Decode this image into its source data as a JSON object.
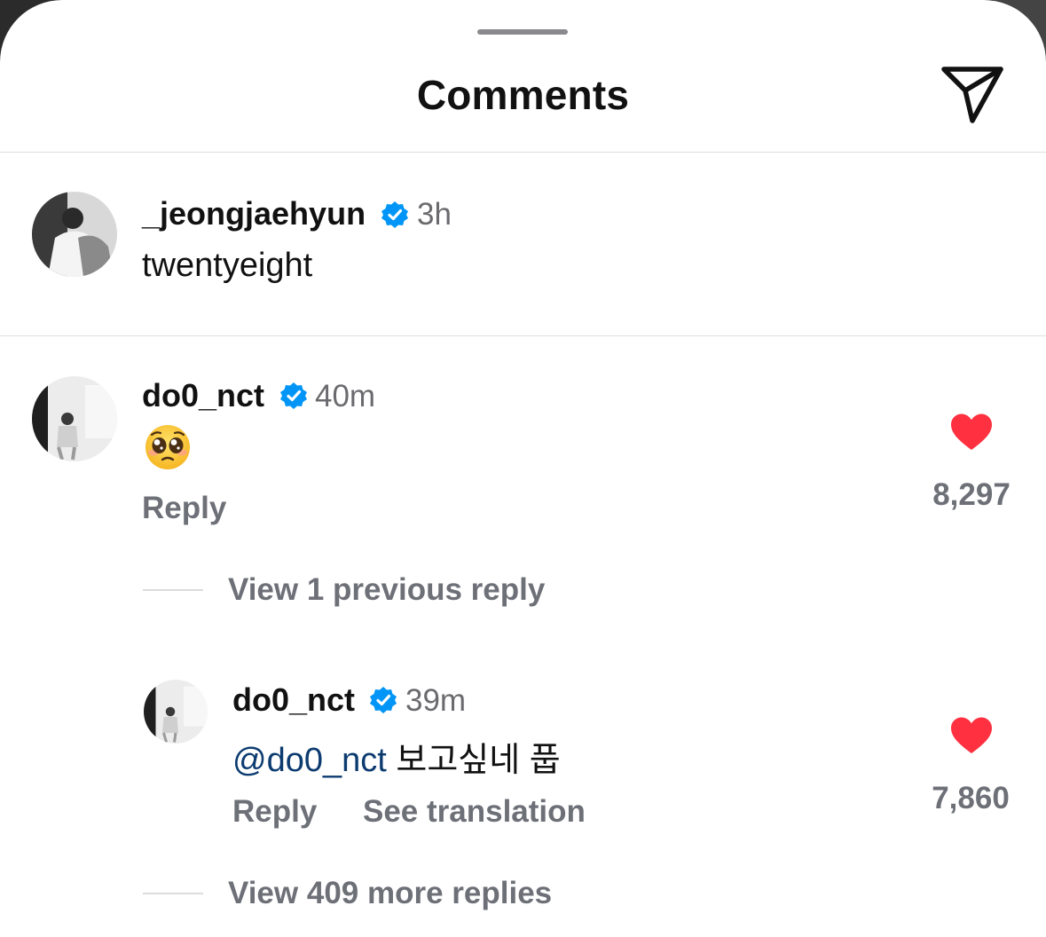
{
  "header": {
    "title": "Comments",
    "share_icon": "paper-plane-icon"
  },
  "post_caption": {
    "username": "_jeongjaehyun",
    "verified": true,
    "time": "3h",
    "text": "twentyeight"
  },
  "comments": [
    {
      "username": "do0_nct",
      "verified": true,
      "time": "40m",
      "text_emoji": "pleading-face-emoji",
      "reply_label": "Reply",
      "liked": true,
      "likes": "8,297",
      "view_previous_label": "View 1 previous reply",
      "replies": [
        {
          "username": "do0_nct",
          "verified": true,
          "time": "39m",
          "mention": "@do0_nct",
          "text": "보고싶네 풉",
          "reply_label": "Reply",
          "translate_label": "See translation",
          "liked": true,
          "likes": "7,860"
        }
      ],
      "view_more_label": "View 409 more replies"
    }
  ],
  "colors": {
    "like_red": "#ff3040",
    "verified_blue": "#0095f6",
    "secondary_text": "#6e7078",
    "mention_blue": "#0c3b70"
  }
}
